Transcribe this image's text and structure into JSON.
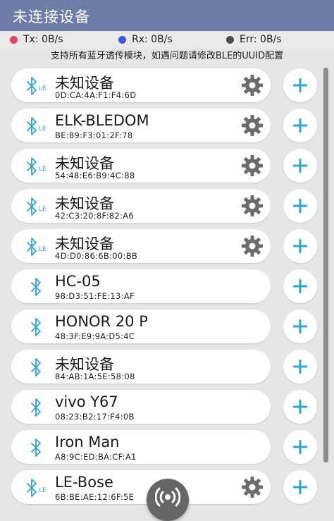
{
  "header": {
    "title": "未连接设备"
  },
  "stats": {
    "tx": "Tx: 0B/s",
    "rx": "Rx: 0B/s",
    "err": "Err: 0B/s",
    "colors": {
      "tx": "#e8445a",
      "rx": "#3a56e8",
      "err": "#4a4a4a"
    }
  },
  "hint": "支持所有蓝牙透传模块，如遇问题请修改BLE的UUID配置",
  "accent_color": "#2aa7d6",
  "devices": [
    {
      "name": "未知设备",
      "mac": "0D:CA:4A:F1:F4:6D",
      "ble": true
    },
    {
      "name": "ELK-BLEDOM",
      "mac": "BE:89:F3:01:2F:78",
      "ble": true
    },
    {
      "name": "未知设备",
      "mac": "54:48:E6:B9:4C:88",
      "ble": true
    },
    {
      "name": "未知设备",
      "mac": "42:C3:20:8F:82:A6",
      "ble": true
    },
    {
      "name": "未知设备",
      "mac": "4D:D0:86:6B:00:BB",
      "ble": true
    },
    {
      "name": "HC-05",
      "mac": "98:D3:51:FE:13:AF",
      "ble": false
    },
    {
      "name": "HONOR 20 P",
      "mac": "48:3F:E9:9A:D5:4C",
      "ble": false
    },
    {
      "name": "未知设备",
      "mac": "84:AB:1A:5E:58:08",
      "ble": false
    },
    {
      "name": "vivo Y67",
      "mac": "08:23:B2:17:F4:0B",
      "ble": false
    },
    {
      "name": "Iron Man",
      "mac": "A8:9C:ED:BA:CF:A1",
      "ble": false
    },
    {
      "name": "LE-Bose",
      "mac": "6B:BE:AE:12:6F:5E",
      "ble": true
    }
  ],
  "ble_badge": "LE",
  "icons": {
    "bluetooth": "bluetooth-icon",
    "settings": "gear-icon",
    "add": "plus-icon",
    "fab": "broadcast-icon"
  }
}
